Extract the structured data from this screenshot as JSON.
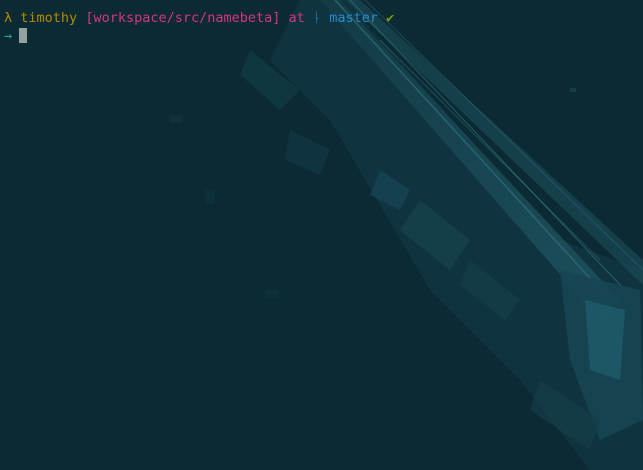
{
  "terminal": {
    "line1": {
      "lambda": "λ",
      "user": "timothy",
      "path": "[workspace/src/namebeta]",
      "at": "at",
      "branch_icon": "ᚿ",
      "branch": "master",
      "status_check": "✔"
    },
    "line2": {
      "arrow": "→"
    }
  },
  "colors": {
    "background": "#0b2a33",
    "lambda_user": "#b58900",
    "path": "#d33682",
    "branch": "#268bd2",
    "check": "#859900",
    "arrow": "#2aa198",
    "cursor": "#93a1a1"
  }
}
